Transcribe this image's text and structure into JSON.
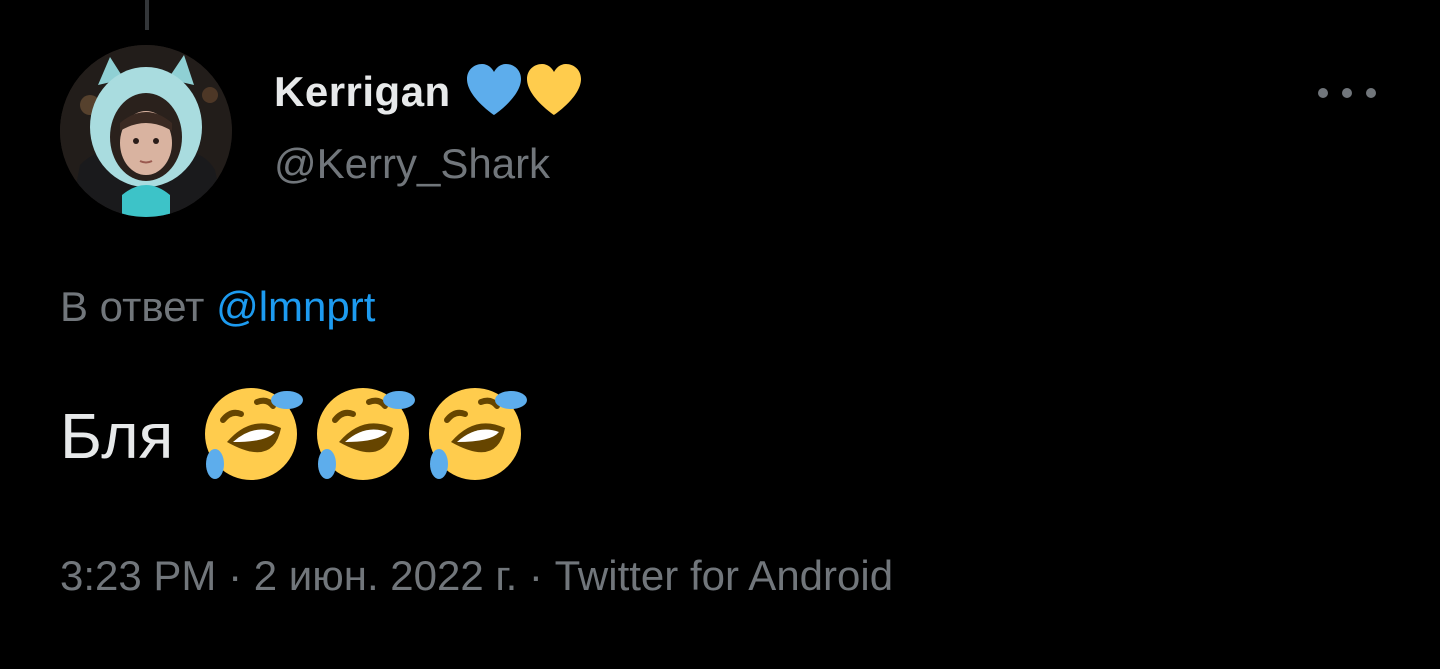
{
  "tweet": {
    "author": {
      "display_name": "Kerrigan",
      "handle": "@Kerry_Shark",
      "avatar": "avatar-photo",
      "badges": [
        {
          "icon": "blue-heart-icon",
          "color": "#5dadec"
        },
        {
          "icon": "yellow-heart-icon",
          "color": "#ffcc4d"
        }
      ]
    },
    "more_icon": "more-horizontal-icon",
    "reply_to": {
      "prefix": "В ответ",
      "mention": "@lmnprt"
    },
    "text": "Бля",
    "emojis": [
      "rolling-on-floor-laughing",
      "rolling-on-floor-laughing",
      "rolling-on-floor-laughing"
    ],
    "meta": {
      "time": "3:23 PM",
      "separator": "·",
      "date": "2 июн. 2022 г.",
      "source": "Twitter for Android"
    }
  },
  "colors": {
    "background": "#000000",
    "primary_text": "#e7e9ea",
    "secondary_text": "#71767b",
    "link": "#1d9bf0"
  }
}
